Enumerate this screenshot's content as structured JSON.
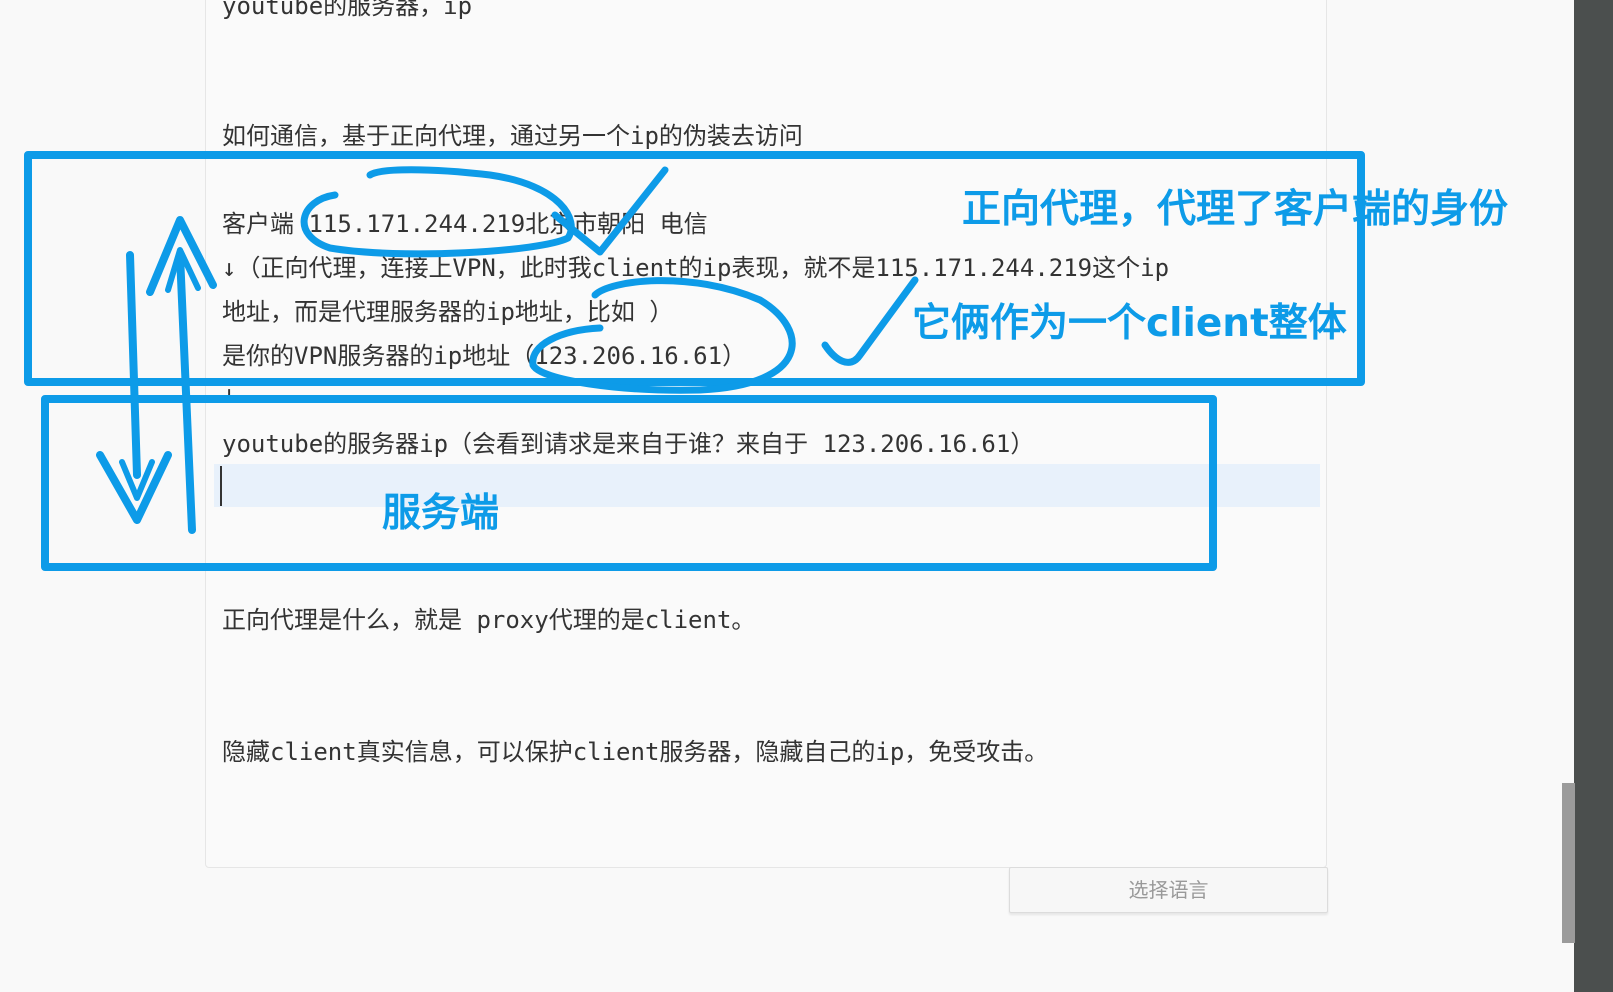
{
  "document": {
    "lines": [
      "youtube的服务器，ip",
      "如何通信，基于正向代理，通过另一个ip的伪装去访问",
      "客户端 115.171.244.219北京市朝阳 电信",
      "↓（正向代理，连接上VPN，此时我client的ip表现，就不是115.171.244.219这个ip",
      "地址，而是代理服务器的ip地址，比如 ）",
      "是你的VPN服务器的ip地址（123.206.16.61）",
      "↓",
      "youtube的服务器ip（会看到请求是来自于谁？来自于 123.206.16.61）",
      "正向代理是什么，就是 proxy代理的是client。",
      "隐藏client真实信息，可以保护client服务器，隐藏自己的ip，免受攻击。"
    ]
  },
  "language_button": {
    "label": "选择语言"
  },
  "annotations": {
    "forward_proxy_note": "正向代理，代理了客户端的身份",
    "client_whole_note": "它俩作为一个client整体",
    "server_label": "服务端"
  },
  "colors": {
    "annotation": "#0d9be8",
    "text": "#333333",
    "highlight": "#e8f1fb"
  }
}
